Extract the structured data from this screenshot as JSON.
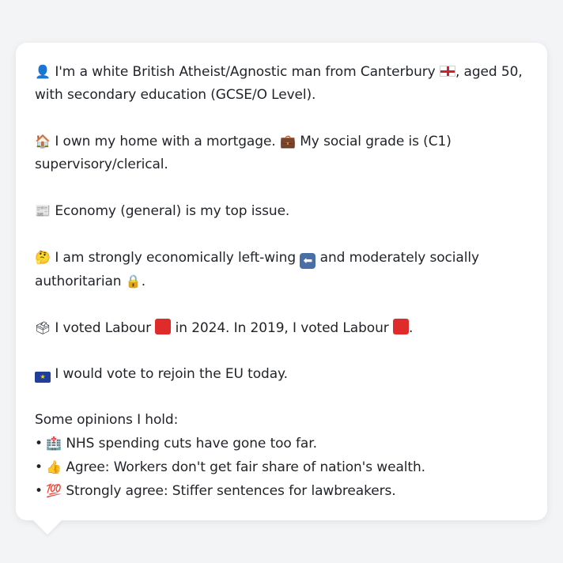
{
  "profile": {
    "intro": {
      "icon": "bust-in-silhouette-icon",
      "line1_a": "I'm a white British Atheist/Agnostic man from Canterbury",
      "line1_b": ", aged 50,",
      "line2": "with secondary education (GCSE/O Level)."
    },
    "home": {
      "icon": "house-icon",
      "line1_a": "I own my home with a mortgage.",
      "line1_b": "My social grade is (C1)",
      "line2": "supervisory/clerical."
    },
    "issue": {
      "icon": "newspaper-icon",
      "text": "Economy (general) is my top issue."
    },
    "ideology": {
      "icon": "thinking-face-icon",
      "line1_a": "I am strongly economically left-wing",
      "line1_b": "and moderately socially",
      "line2": "authoritarian",
      "line2_end": "."
    },
    "votes": {
      "icon": "ballot-box-icon",
      "part_a": "I voted Labour",
      "part_b": "in 2024. In 2019, I voted Labour",
      "part_end": "."
    },
    "eu": {
      "icon": "eu-flag-icon",
      "text": "I would vote to rejoin the EU today."
    },
    "opinions": {
      "heading": "Some opinions I hold:",
      "items": [
        {
          "bullet": "•",
          "icon": "hospital-icon",
          "text": "NHS spending cuts have gone too far."
        },
        {
          "bullet": "•",
          "icon": "thumbs-up-icon",
          "text": "Agree: Workers don't get fair share of nation's wealth."
        },
        {
          "bullet": "•",
          "icon": "hundred-points-icon",
          "text": "Strongly agree: Stiffer sentences for lawbreakers."
        }
      ]
    }
  },
  "colors": {
    "background": "#f3f4f6",
    "bubble": "#ffffff",
    "text": "#1f2328",
    "labour_red": "#e02b2b"
  }
}
